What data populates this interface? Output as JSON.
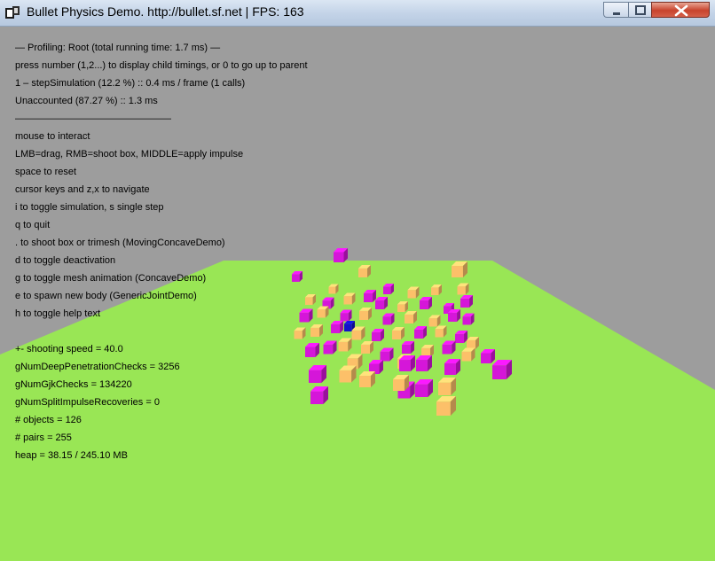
{
  "window": {
    "title": "Bullet Physics Demo. http://bullet.sf.net | FPS: 163"
  },
  "hud": {
    "lines": [
      "— Profiling: Root (total running time: 1.7 ms) —",
      "press number (1,2...) to display child timings, or 0 to go up to parent",
      "1 – stepSimulation (12.2 %) :: 0.4 ms / frame (1 calls)",
      "Unaccounted (87.27 %) :: 1.3 ms",
      "————————————————",
      "mouse to interact",
      "LMB=drag, RMB=shoot box, MIDDLE=apply impulse",
      "space to reset",
      "cursor keys and z,x to navigate",
      "i to toggle simulation, s single step",
      "q to quit",
      ". to shoot box or trimesh (MovingConcaveDemo)",
      "d to toggle deactivation",
      "g to toggle mesh animation (ConcaveDemo)",
      "e to spawn new body (GenericJointDemo)",
      "h to toggle help text",
      "",
      "+- shooting speed = 40.0",
      "gNumDeepPenetrationChecks = 3256",
      "gNumGjkChecks = 134220",
      "gNumSplitImpulseRecoveries = 0",
      "# objects = 126",
      "# pairs = 255",
      "heap = 38.15 / 245.10 MB"
    ]
  },
  "colors": {
    "background": "#9d9d9d",
    "ground": "#99e655",
    "box_magenta": "#d516d9",
    "box_orange": "#fcc069",
    "box_blue": "#1212c8"
  }
}
